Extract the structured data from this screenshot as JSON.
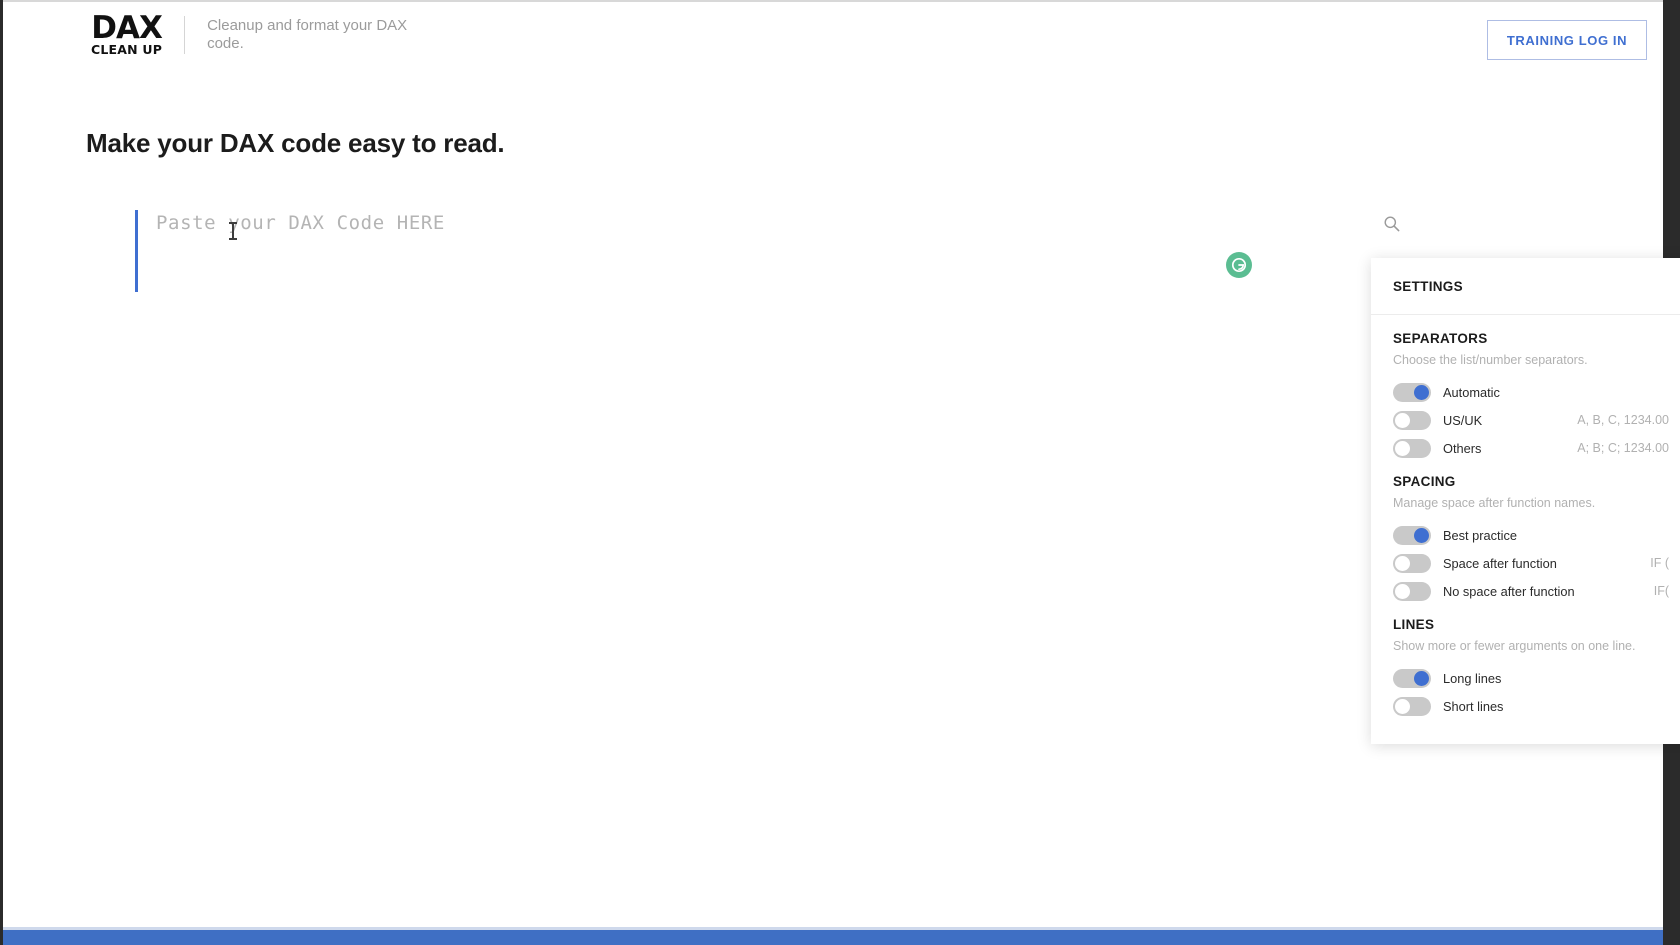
{
  "header": {
    "logo_main": "DAX",
    "logo_sub": "CLEAN UP",
    "tagline": "Cleanup and format your DAX code.",
    "login_label": "TRAINING LOG IN"
  },
  "page": {
    "title": "Make your DAX code easy to read."
  },
  "editor": {
    "placeholder": "Paste your DAX Code HERE",
    "value": "",
    "badge_icon": "grammarly-icon",
    "caret_color": "#3f6fd1"
  },
  "search": {
    "icon": "search-icon"
  },
  "settings": {
    "title": "SETTINGS",
    "groups": [
      {
        "title": "SEPARATORS",
        "description": "Choose the list/number separators.",
        "options": [
          {
            "label": "Automatic",
            "example": "",
            "on": true
          },
          {
            "label": "US/UK",
            "example": "A, B, C, 1234.00",
            "on": false
          },
          {
            "label": "Others",
            "example": "A; B; C; 1234.00",
            "on": false
          }
        ]
      },
      {
        "title": "SPACING",
        "description": "Manage space after function names.",
        "options": [
          {
            "label": "Best practice",
            "example": "",
            "on": true
          },
          {
            "label": "Space after function",
            "example": "IF (",
            "on": false
          },
          {
            "label": "No space after function",
            "example": "IF(",
            "on": false
          }
        ]
      },
      {
        "title": "LINES",
        "description": "Show more or fewer arguments on one line.",
        "options": [
          {
            "label": "Long lines",
            "example": "",
            "on": true
          },
          {
            "label": "Short lines",
            "example": "",
            "on": false
          }
        ]
      }
    ]
  },
  "colors": {
    "accent_blue": "#3f6fd1",
    "bottom_bar": "#3f6fc4",
    "toggle_track": "#c9c9c9",
    "badge_green": "#5bbd92",
    "muted_text": "#b1b1b1"
  }
}
